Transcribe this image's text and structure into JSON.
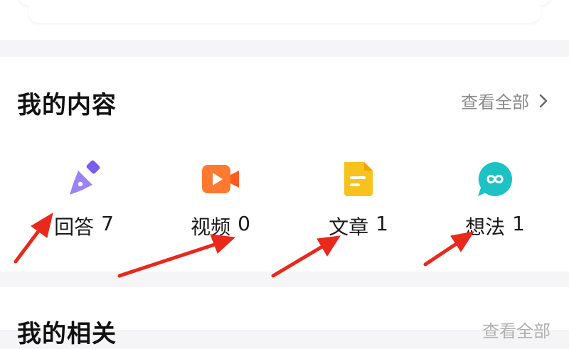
{
  "my_content": {
    "title": "我的内容",
    "view_all": "查看全部",
    "items": [
      {
        "label": "回答",
        "count": "7",
        "icon": "pen-nib-icon",
        "color": "#7b5cf0"
      },
      {
        "label": "视频",
        "count": "0",
        "icon": "video-camera-icon",
        "color": "#ff7a30"
      },
      {
        "label": "文章",
        "count": "1",
        "icon": "document-icon",
        "color": "#f7c21e"
      },
      {
        "label": "想法",
        "count": "1",
        "icon": "chat-bubble-icon",
        "color": "#1cc2c4"
      }
    ]
  },
  "next_section": {
    "title": "我的相关",
    "right_text": "查看全部"
  },
  "colors": {
    "annotation_arrow": "#e8291c",
    "page_bg": "#f5f5f7"
  }
}
